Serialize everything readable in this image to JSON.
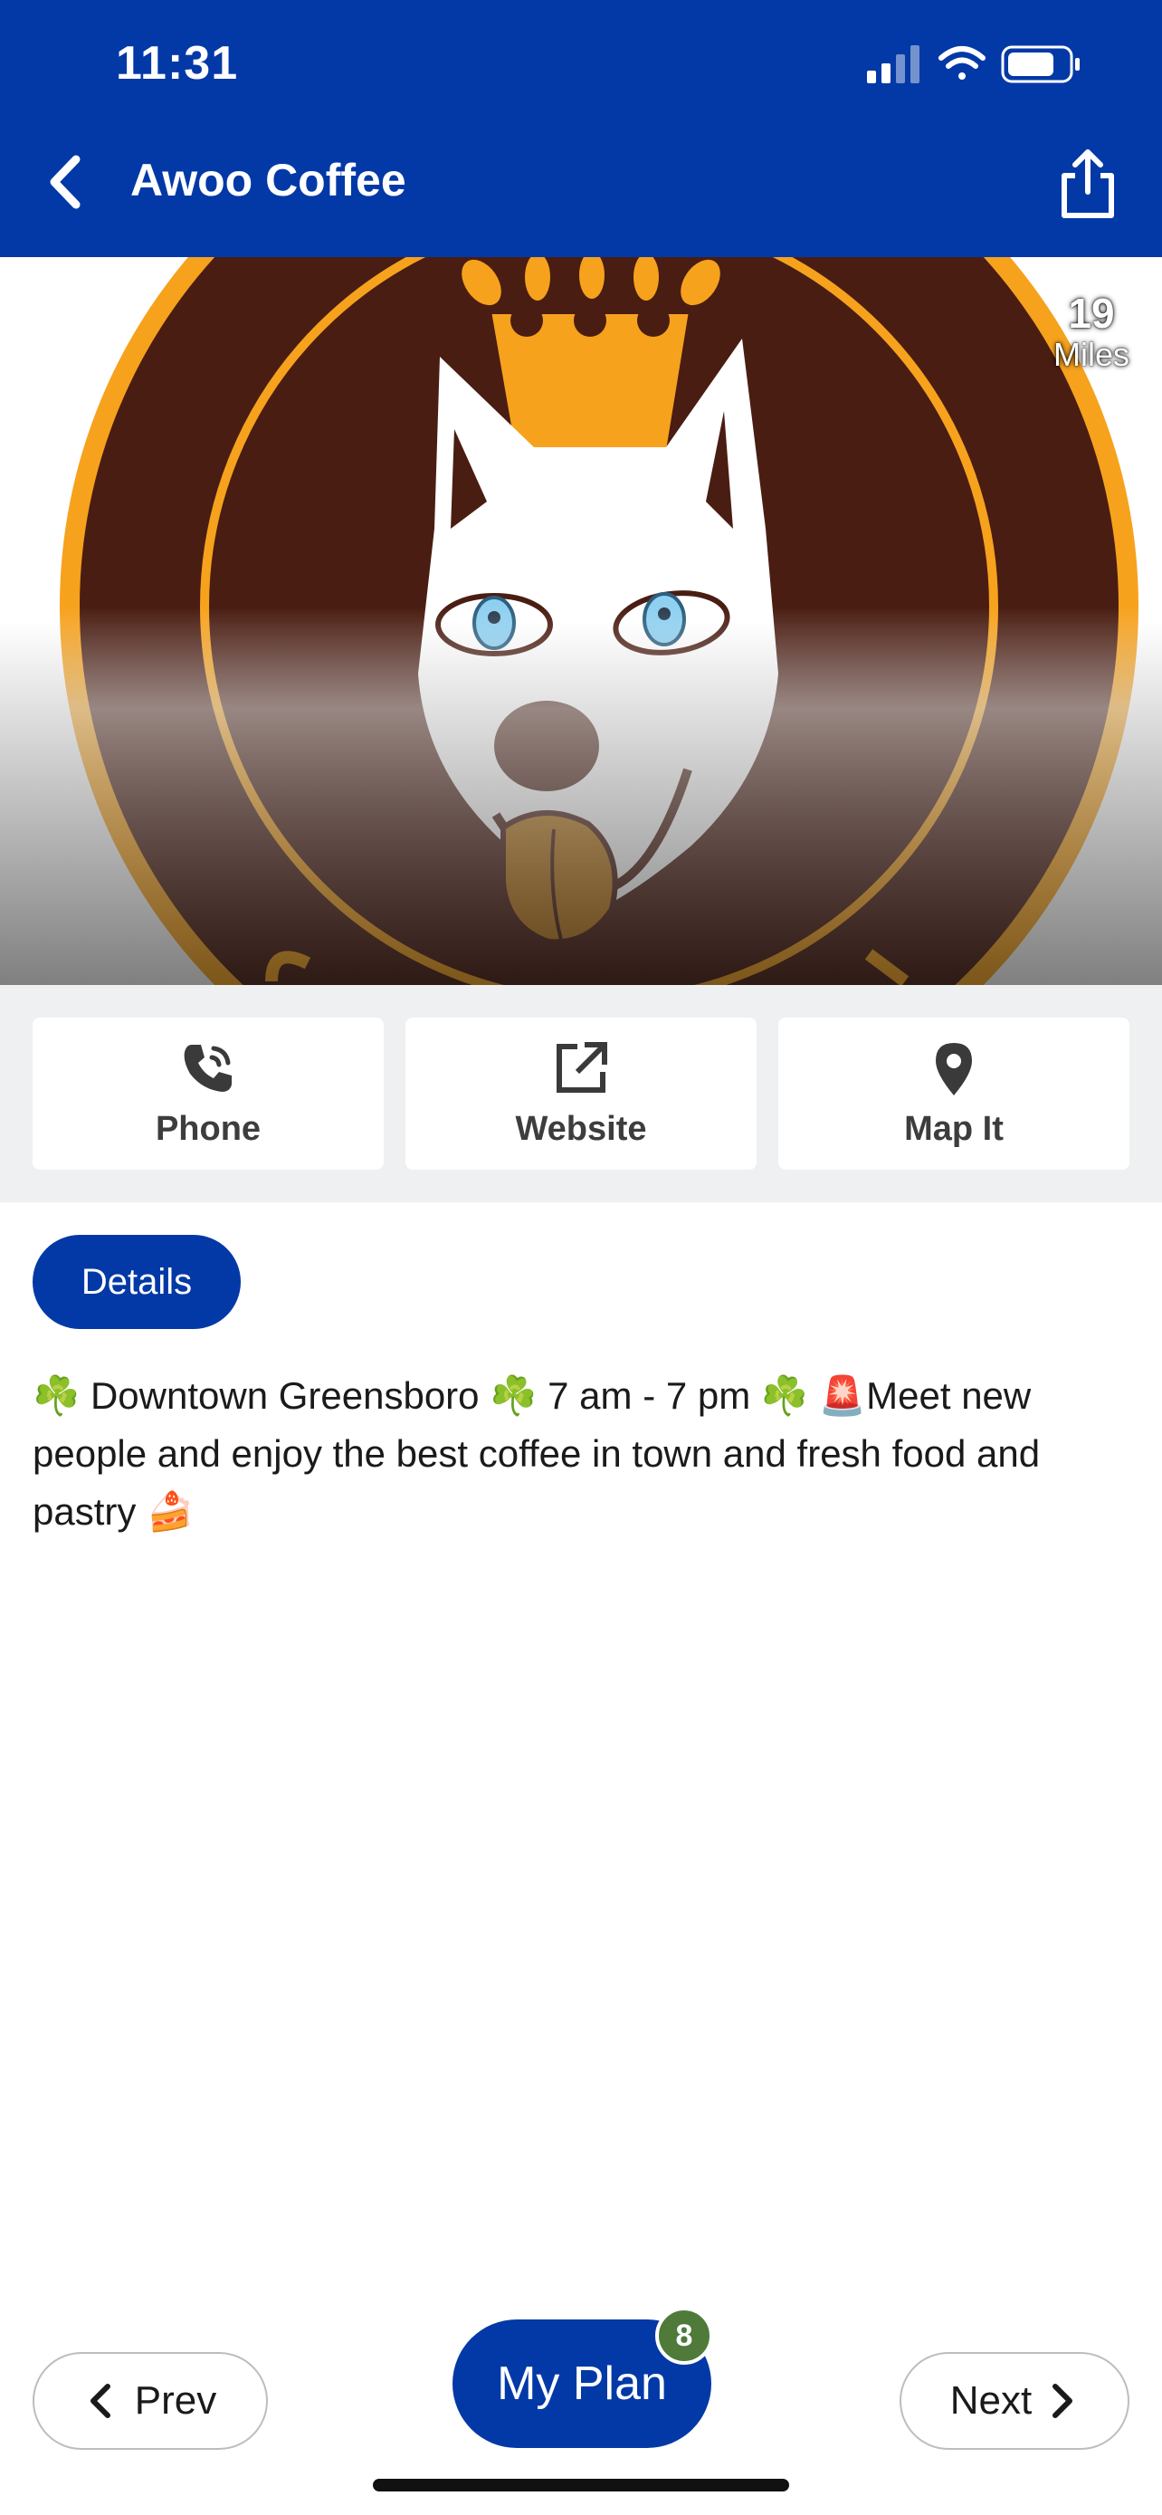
{
  "status_bar": {
    "time": "11:31"
  },
  "header": {
    "title": "Awoo Coffee"
  },
  "hero": {
    "distance_value": "19",
    "distance_unit": "Miles"
  },
  "actions": [
    {
      "label": "Phone",
      "icon": "phone-icon"
    },
    {
      "label": "Website",
      "icon": "external-link-icon"
    },
    {
      "label": "Map It",
      "icon": "map-pin-icon"
    }
  ],
  "details": {
    "tab_label": "Details",
    "description": "☘️ Downtown Greensboro ☘️ 7 am - 7 pm ☘️ 🚨Meet new people and enjoy the best coffee in town and fresh food and pastry 🍰"
  },
  "bottom_bar": {
    "prev_label": "Prev",
    "next_label": "Next",
    "plan_label": "My Plan",
    "plan_count": "8"
  },
  "colors": {
    "brand_blue": "#0339a6",
    "badge_green": "#4f7a3a",
    "action_bg": "#eef0f2"
  }
}
